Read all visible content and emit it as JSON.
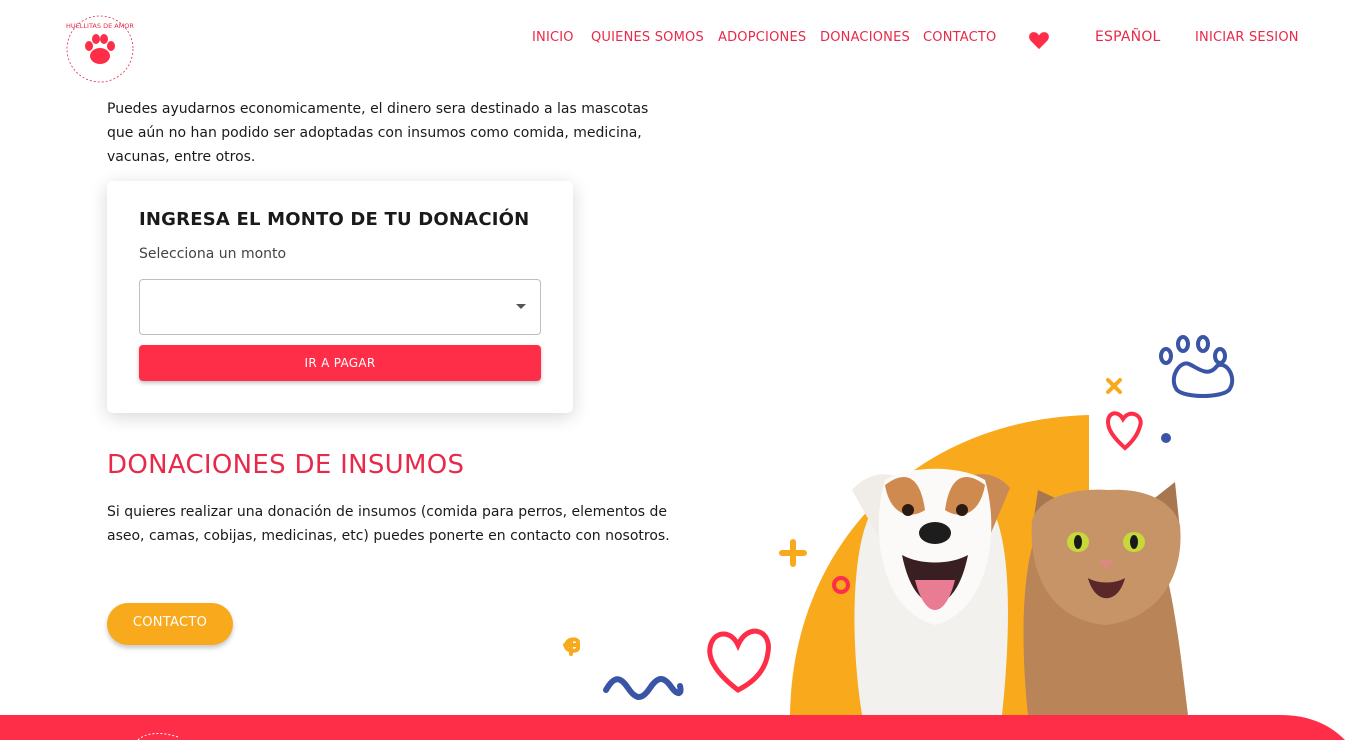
{
  "brand": {
    "logo_alt": "Huellitas de Amor",
    "logo_ring_text": "HUELLITAS DE AMOR"
  },
  "nav": {
    "items": [
      {
        "label": "INICIO"
      },
      {
        "label": "QUIENES SOMOS"
      },
      {
        "label": "ADOPCIONES"
      },
      {
        "label": "DONACIONES"
      },
      {
        "label": "CONTACTO"
      }
    ],
    "favorites_icon": "heart-icon",
    "language": "ESPAÑOL",
    "login": "INICIAR SESION"
  },
  "intro": {
    "text": "Puedes ayudarnos economicamente, el dinero sera destinado a las mascotas que aún no han podido ser adoptadas con insumos como comida, medicina, vacunas, entre otros."
  },
  "donation_form": {
    "title": "INGRESA EL MONTO DE TU DONACIÓN",
    "label": "Selecciona un monto",
    "selected_value": "",
    "pay_button": "IR A PAGAR"
  },
  "supplies": {
    "title": "DONACIONES DE INSUMOS",
    "text": "Si quieres realizar una donación de insumos (comida para perros, elementos de aseo, camas, cobijas, medicinas, etc) puedes ponerte en contacto con nosotros.",
    "contact_button": "CONTACTO"
  },
  "colors": {
    "primary_red": "#ff2e48",
    "nav_red": "#e8294a",
    "orange": "#f9a91c",
    "navy": "#3a55a5"
  }
}
